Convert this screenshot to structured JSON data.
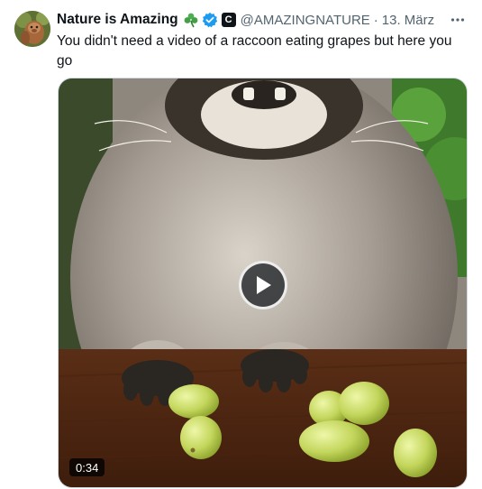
{
  "tweet": {
    "author": {
      "display_name": "Nature is Amazing",
      "emoji_icon": "shamrock-icon",
      "verified_icon": "verified-badge-icon",
      "affiliate_badge": "C",
      "handle": "@AMAZINGNATURE",
      "separator": "·",
      "date": "13. März"
    },
    "more_icon": "more-horizontal-icon",
    "text": "You didn't need a video of a raccoon eating grapes but here you go",
    "media": {
      "type": "video",
      "play_icon": "play-icon",
      "duration": "0:34"
    }
  },
  "colors": {
    "text_primary": "#0f1419",
    "text_secondary": "#536471",
    "verified_blue": "#1d9bf0",
    "border": "#cfd9de"
  }
}
